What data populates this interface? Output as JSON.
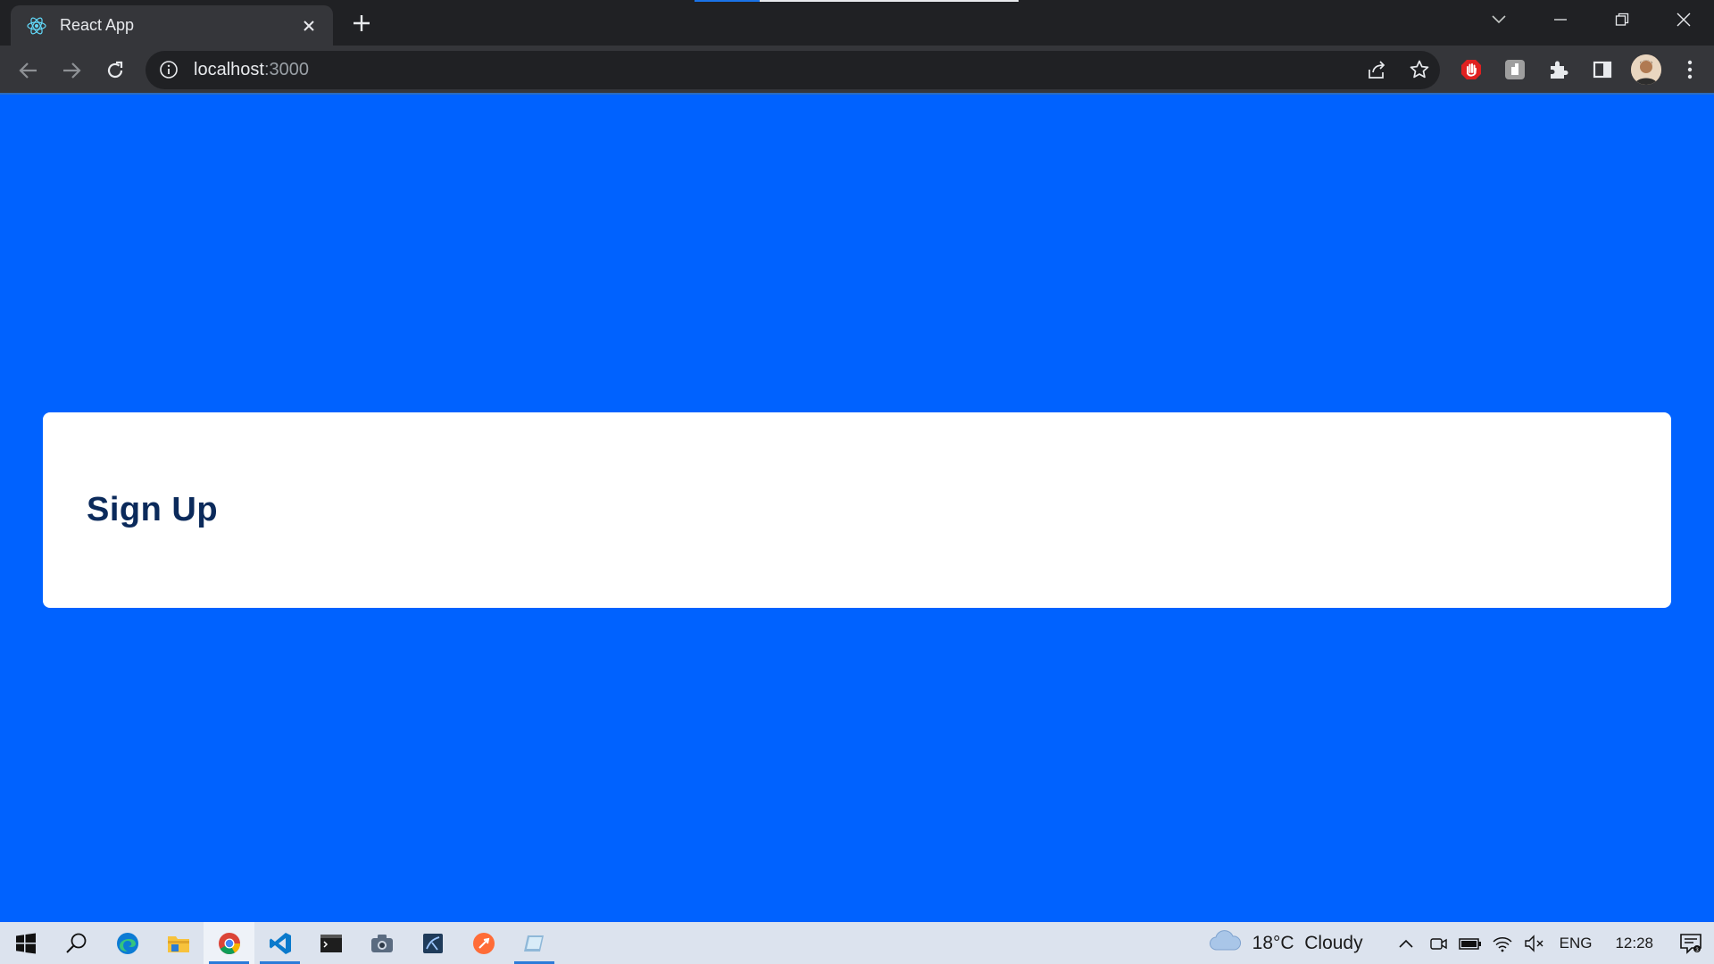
{
  "browser": {
    "tab_title": "React App",
    "url_host": "localhost",
    "url_port": ":3000"
  },
  "page": {
    "heading": "Sign Up"
  },
  "taskbar": {
    "weather": "18°C  Cloudy",
    "language": "ENG",
    "clock": "12:28"
  },
  "colors": {
    "page_background": "#0062ff",
    "card_background": "#ffffff",
    "heading": "#0b2a5b"
  }
}
